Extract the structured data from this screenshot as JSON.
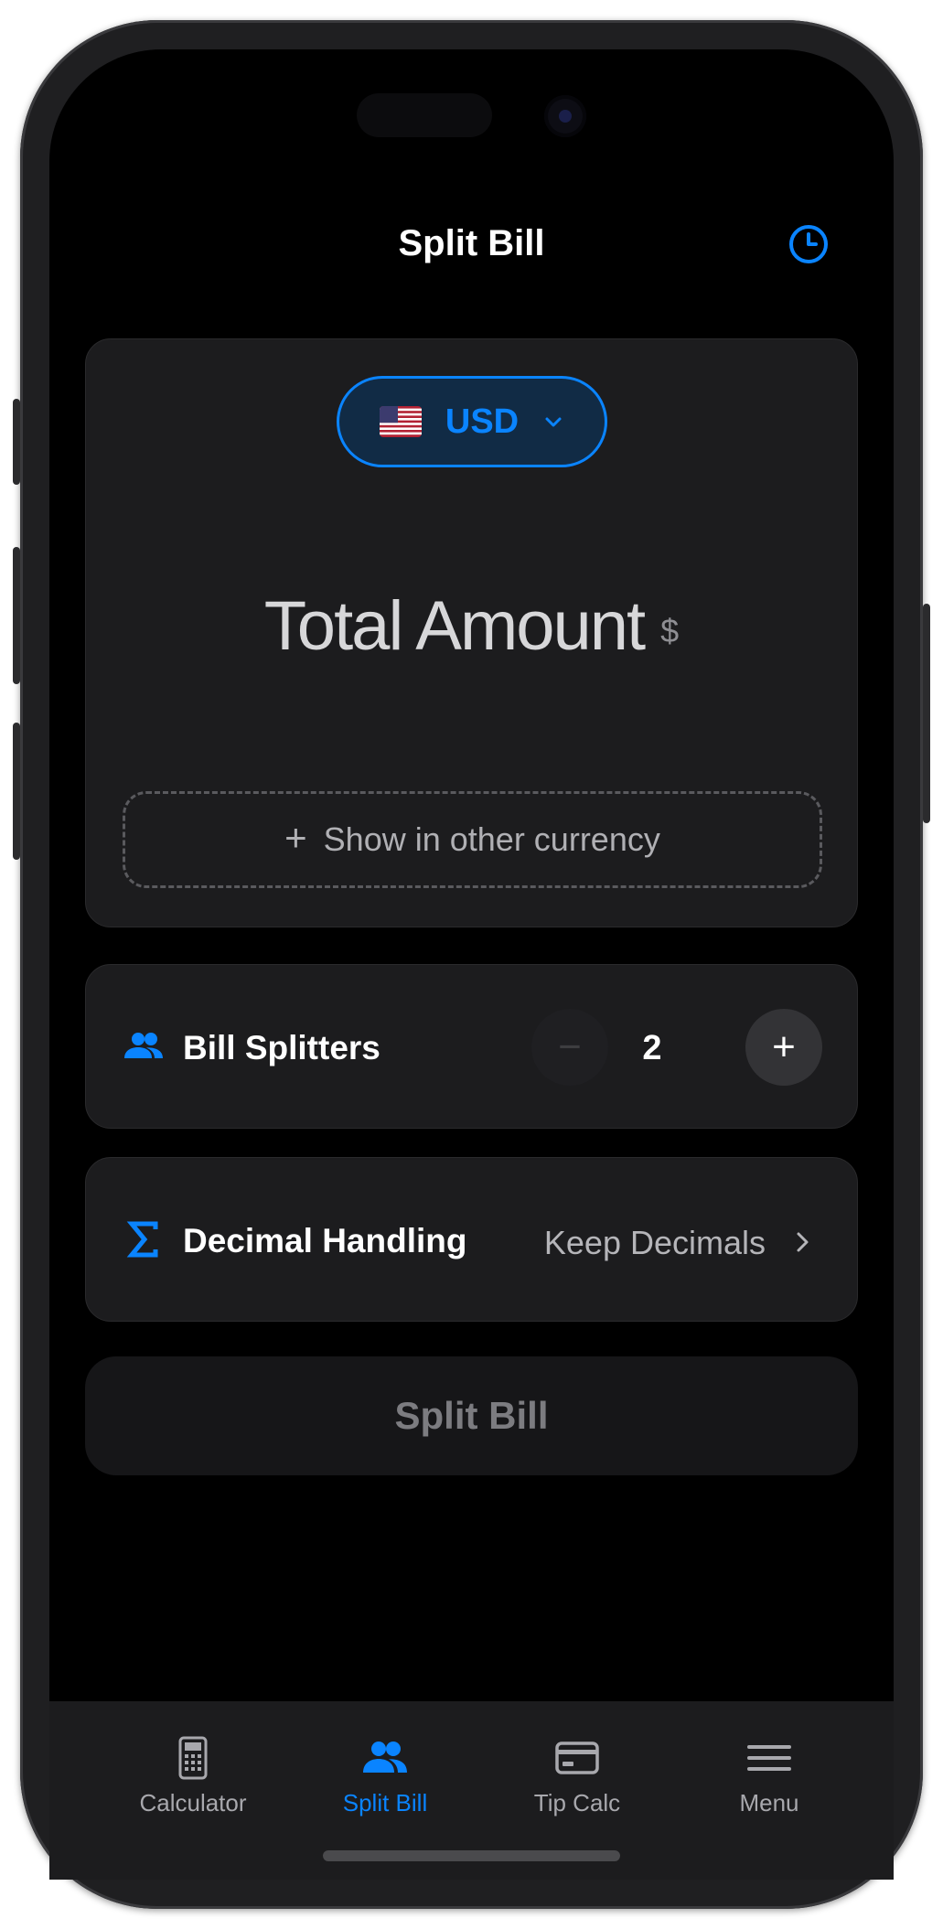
{
  "header": {
    "title": "Split Bill",
    "history_icon": "clock-icon"
  },
  "currency": {
    "flag_icon": "us-flag-icon",
    "code": "USD"
  },
  "amount": {
    "placeholder": "Total Amount",
    "symbol": "$"
  },
  "other_currency": {
    "label": "Show in other currency"
  },
  "splitters": {
    "label": "Bill Splitters",
    "icon": "people-icon",
    "minus": "−",
    "plus": "+",
    "value": "2"
  },
  "decimal": {
    "label": "Decimal Handling",
    "icon": "sigma-icon",
    "value": "Keep Decimals"
  },
  "action": {
    "split_label": "Split Bill"
  },
  "tabs": [
    {
      "label": "Calculator",
      "icon": "calculator-icon",
      "active": false
    },
    {
      "label": "Split Bill",
      "icon": "people-icon",
      "active": true
    },
    {
      "label": "Tip Calc",
      "icon": "card-icon",
      "active": false
    },
    {
      "label": "Menu",
      "icon": "menu-icon",
      "active": false
    }
  ],
  "colors": {
    "accent": "#0a84ff",
    "background": "#000000",
    "card": "#1c1c1e"
  }
}
